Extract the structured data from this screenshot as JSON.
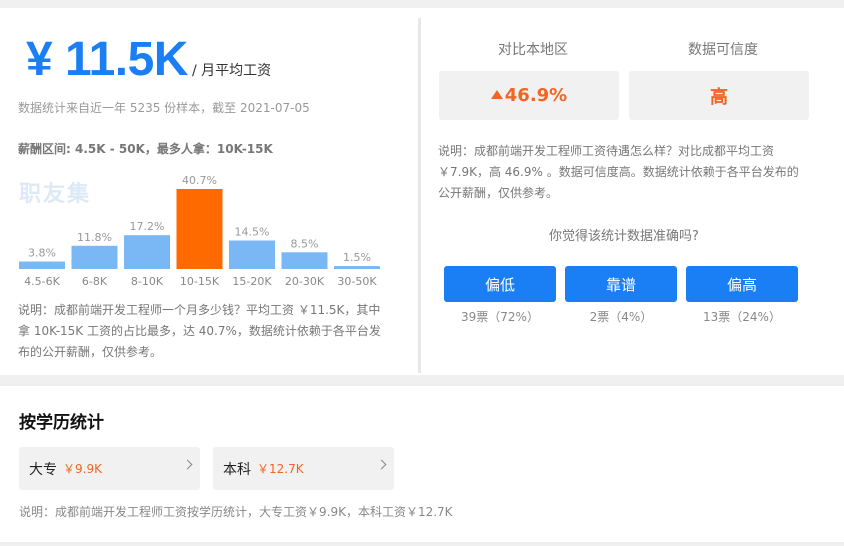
{
  "salary": {
    "value": "¥ 11.5K",
    "unit": "/ 月平均工资",
    "source_text": "数据统计来自近一年 5235 份样本，截至 2021-07-05",
    "range_text": "薪酬区间: 4.5K - 50K，最多人拿：10K-15K",
    "watermark": "职友集"
  },
  "chart_data": {
    "type": "bar",
    "categories": [
      "4.5-6K",
      "6-8K",
      "8-10K",
      "10-15K",
      "15-20K",
      "20-30K",
      "30-50K"
    ],
    "values": [
      3.8,
      11.8,
      17.2,
      40.7,
      14.5,
      8.5,
      1.5
    ],
    "value_labels": [
      "3.8%",
      "11.8%",
      "17.2%",
      "40.7%",
      "14.5%",
      "8.5%",
      "1.5%"
    ],
    "highlight_index": 3,
    "colors": {
      "normal": "#7ab8f5",
      "highlight": "#ff6a00"
    }
  },
  "note_left": "说明：成都前端开发工程师一个月多少钱？平均工资 ￥11.5K，其中拿 10K-15K 工资的占比最多，达 40.7%，数据统计依赖于各平台发布的公开薪酬，仅供参考。",
  "compare": {
    "region_label": "对比本地区",
    "region_value": "46.9%",
    "cred_label": "数据可信度",
    "cred_value": "高"
  },
  "note_right": "说明：成都前端开发工程师工资待遇怎么样？对比成都平均工资 ￥7.9K，高 46.9% 。数据可信度高。数据统计依赖于各平台发布的公开薪酬，仅供参考。",
  "vote": {
    "question": "你觉得该统计数据准确吗?",
    "options": [
      {
        "label": "偏低",
        "count": "39票（72%）"
      },
      {
        "label": "靠谱",
        "count": "2票（4%）"
      },
      {
        "label": "偏高",
        "count": "13票（24%）"
      }
    ]
  },
  "education": {
    "title": "按学历统计",
    "items": [
      {
        "name": "大专",
        "salary": "￥9.9K"
      },
      {
        "name": "本科",
        "salary": "￥12.7K"
      }
    ],
    "note": "说明：成都前端开发工程师工资按学历统计，大专工资￥9.9K，本科工资￥12.7K"
  },
  "accent_colors": {
    "blue": "#1a7ff5",
    "orange": "#f26522"
  }
}
